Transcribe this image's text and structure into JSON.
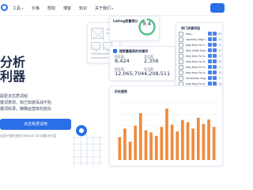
{
  "nav": {
    "items": [
      {
        "label": "工具",
        "has_menu": true
      },
      {
        "label": "价格",
        "has_menu": false
      },
      {
        "label": "帮助",
        "has_menu": false
      },
      {
        "label": "博客",
        "has_menu": false
      },
      {
        "label": "知识",
        "has_menu": false
      },
      {
        "label": "关于我们",
        "has_menu": false
      }
    ]
  },
  "hero": {
    "title_line1": "分析",
    "title_line2": "利器",
    "desc_line1": "掘更多优质词组",
    "desc_line2": "键词表现，知己知彼百战不殆",
    "desc_line3": "键词收录，精确运营有的放矢",
    "cta_label": "点击免费试用",
    "footnote": "佳用户都在使用 Helium 10 的解决方案"
  },
  "gauge_panel": {
    "title": "Listing质量得分",
    "value": "9.4"
  },
  "stats_panel": {
    "title": "搜索量最高的关键词",
    "stats": [
      {
        "label": "搜索量",
        "value": "8,424"
      },
      {
        "label": "竞品数",
        "value": "2,356"
      },
      {
        "label": "搜索量",
        "value": "12,065,704"
      },
      {
        "label": "竞品数",
        "value": "4,208,511"
      }
    ]
  },
  "keywords_panel": {
    "title": "热门关键词组",
    "rows": [
      {
        "text": "dog...",
        "count": "63"
      },
      {
        "text": "squeaky dog t...",
        "count": "44"
      },
      {
        "text": "dog toys for t...",
        "count": "41"
      },
      {
        "text": "dog chew toys",
        "count": "31"
      },
      {
        "text": "dog toys for b...",
        "count": "27"
      },
      {
        "text": "dog toys for b...",
        "count": "26"
      },
      {
        "text": "dog toys for b...",
        "count": "15"
      },
      {
        "text": "dog toys for b...",
        "count": "13"
      },
      {
        "text": "christmas dog...",
        "count": "11"
      },
      {
        "text": "dog toys for b...",
        "count": "10"
      },
      {
        "text": "dog toys for b...",
        "count": "8"
      }
    ]
  },
  "chart_panel": {
    "title": "历史趋势"
  },
  "colors": {
    "accent": "#2b6fe8",
    "bar": "#f08a3c",
    "gauge": "#4fc28a"
  },
  "chart_data": {
    "type": "bar",
    "title": "历史趋势",
    "categories": [
      "1",
      "2",
      "3",
      "4",
      "5",
      "6",
      "7",
      "8",
      "9",
      "10",
      "11",
      "12",
      "13",
      "14",
      "15",
      "16",
      "17",
      "18",
      "19"
    ],
    "series": [
      {
        "values": [
          0.4,
          0.55,
          0.32,
          0.6,
          0.82,
          0.52,
          0.48,
          0.42,
          0.58,
          0.9,
          0.62,
          0.5,
          0.7,
          0.66,
          0.55,
          0.74,
          0.63,
          0.71,
          0.58
        ]
      }
    ],
    "ylim": [
      0,
      1
    ],
    "grid": true
  }
}
